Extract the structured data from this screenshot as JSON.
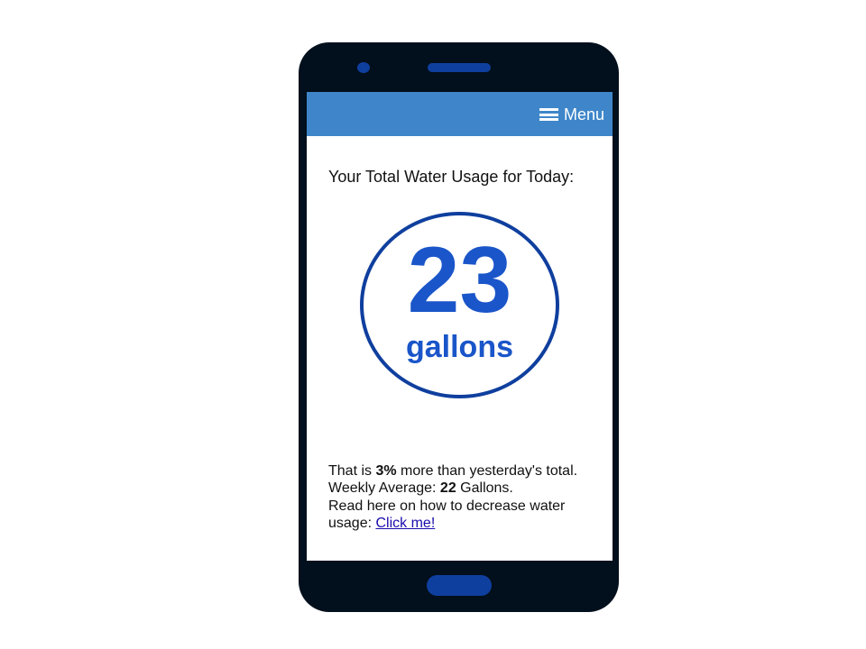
{
  "appbar": {
    "menu_icon": "hamburger-icon",
    "menu_label": "Menu",
    "color": "#3e86c9"
  },
  "usage": {
    "title": "Your Total Water Usage for Today:",
    "value": "23",
    "unit": "gallons",
    "accent_color": "#1a55c9"
  },
  "details": {
    "line1_prefix": "That is ",
    "line1_percent": "3%",
    "line1_suffix": " more than yesterday's total.",
    "line2_prefix": "Weekly Average: ",
    "line2_value": "22",
    "line2_suffix": " Gallons.",
    "line3_text": "Read here on how to decrease water usage: ",
    "link_label": "Click me!"
  },
  "device": {
    "frame_color": "#020f1c",
    "hardware_color": "#0f3f9e"
  }
}
